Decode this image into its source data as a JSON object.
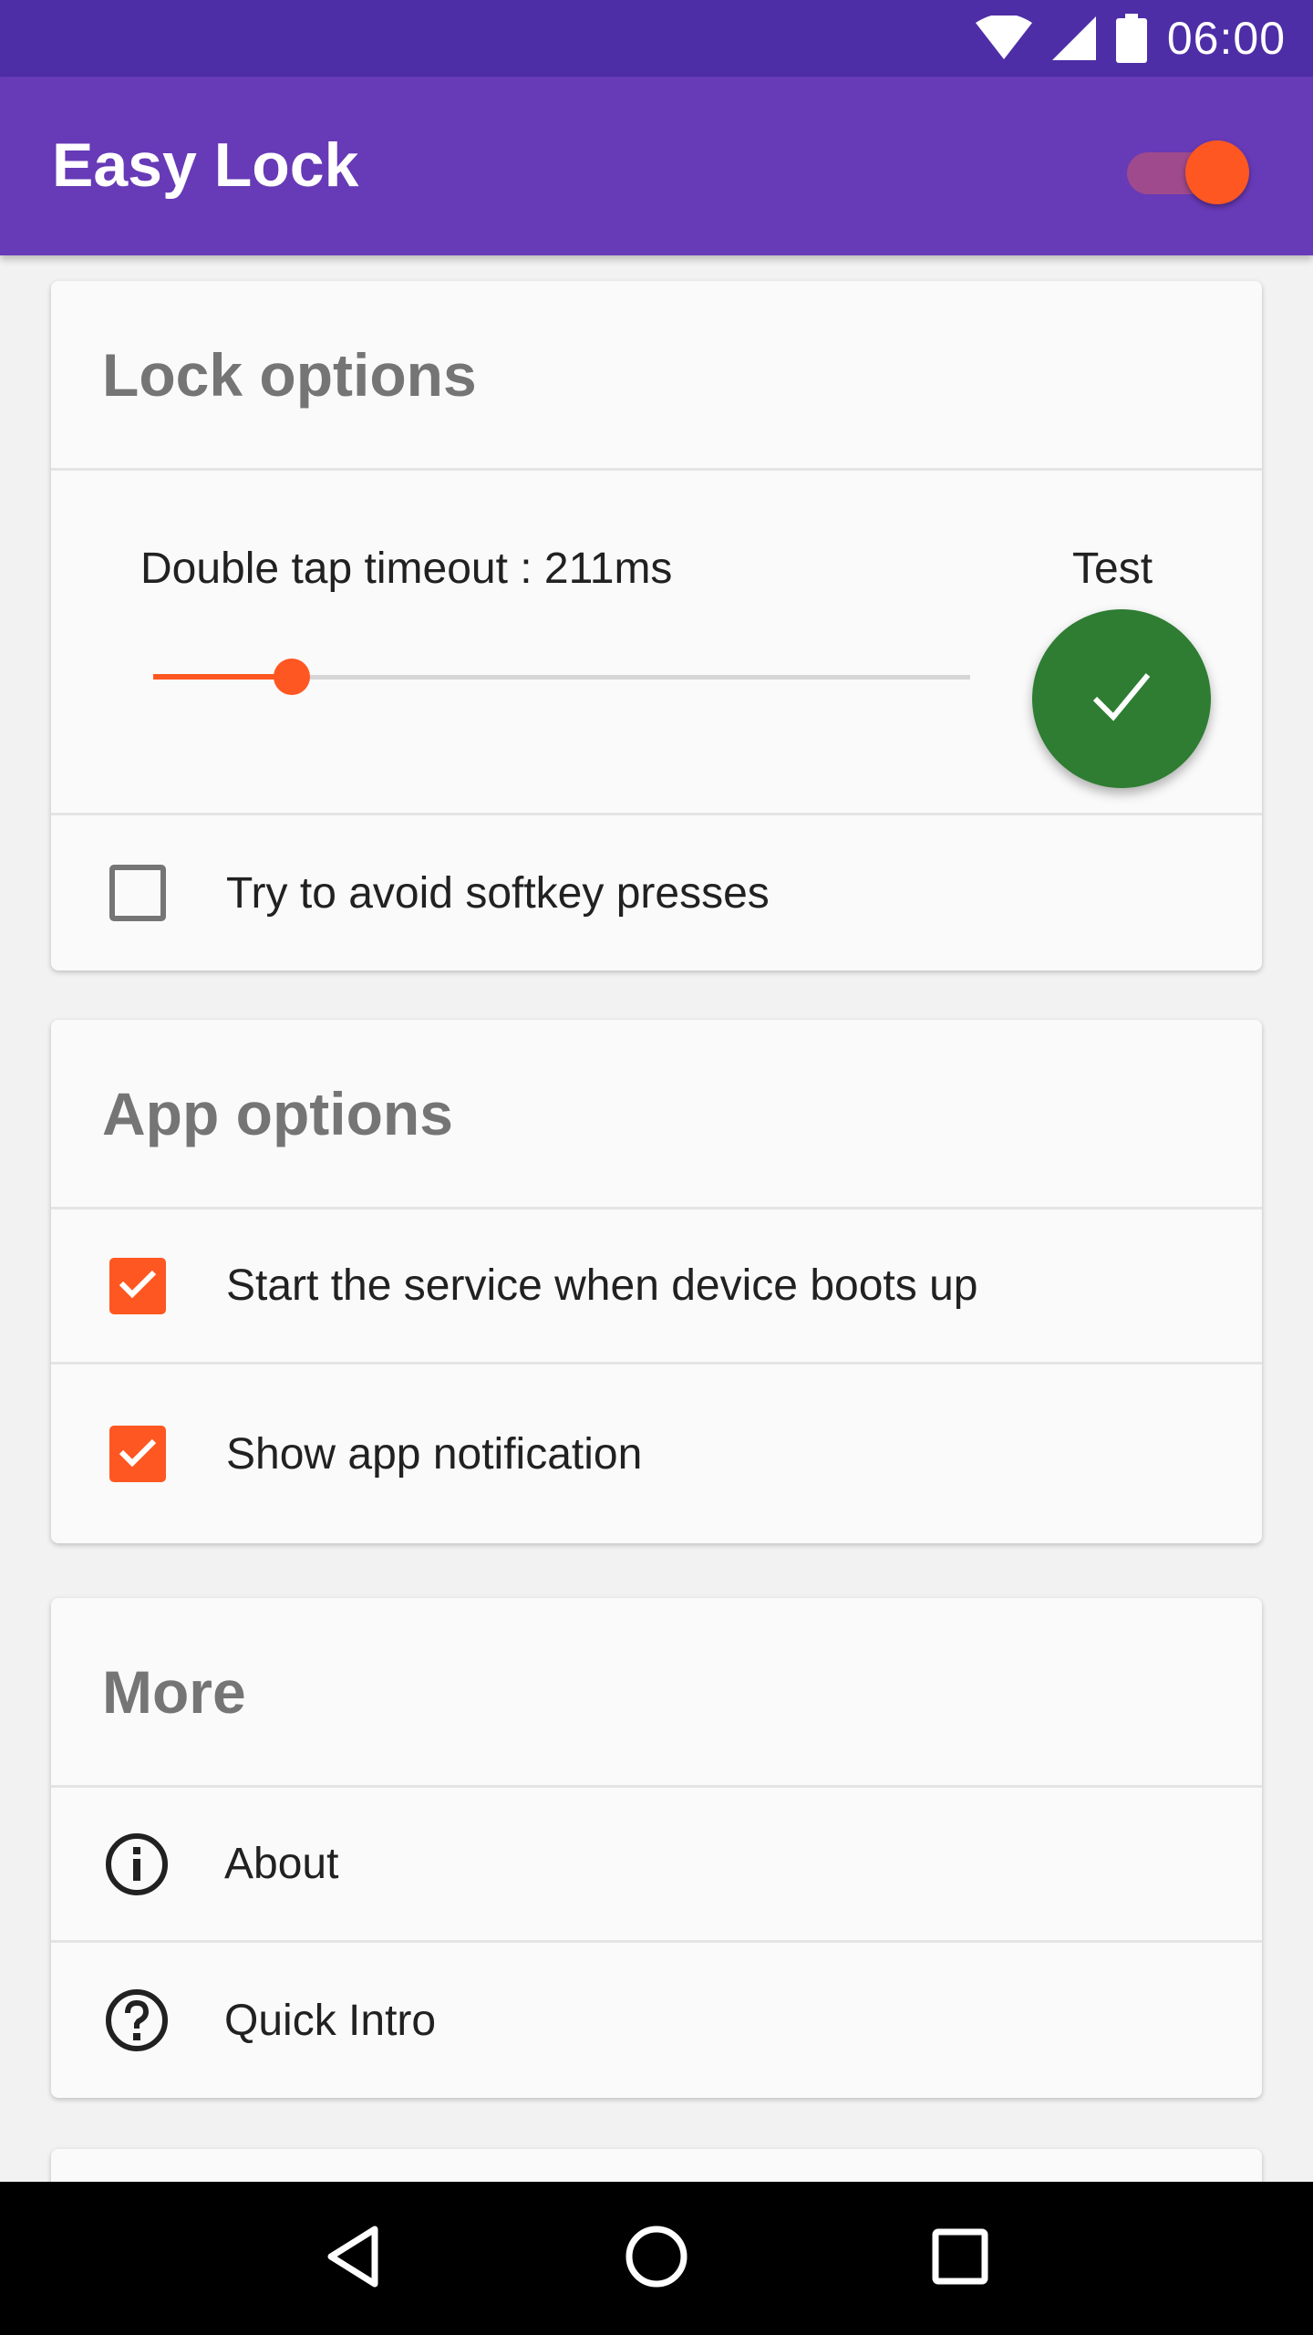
{
  "status_bar": {
    "time": "06:00",
    "battery_level": "100",
    "icons": [
      "wifi-icon",
      "cell-signal-icon",
      "battery-icon"
    ]
  },
  "app_bar": {
    "title": "Easy Lock",
    "service_enabled": true
  },
  "lock_options": {
    "title": "Lock options",
    "timeout_label": "Double tap timeout : 211ms",
    "timeout_fraction": 0.17,
    "test_label": "Test",
    "avoid_softkey": {
      "label": "Try to avoid softkey presses",
      "checked": false
    }
  },
  "app_options": {
    "title": "App options",
    "items": [
      {
        "label": "Start the service when device boots up",
        "checked": true
      },
      {
        "label": "Show app notification",
        "checked": true
      }
    ]
  },
  "more": {
    "title": "More",
    "items": [
      {
        "label": "About",
        "icon": "info-icon"
      },
      {
        "label": "Quick Intro",
        "icon": "help-icon"
      }
    ]
  },
  "nav_bar": {
    "buttons": [
      "back-icon",
      "home-icon",
      "recents-icon"
    ]
  },
  "colors": {
    "status_bar": "#4e2ea6",
    "app_bar": "#673ab7",
    "accent": "#ff5722",
    "fab": "#2e7d32",
    "card_title": "#757575"
  }
}
